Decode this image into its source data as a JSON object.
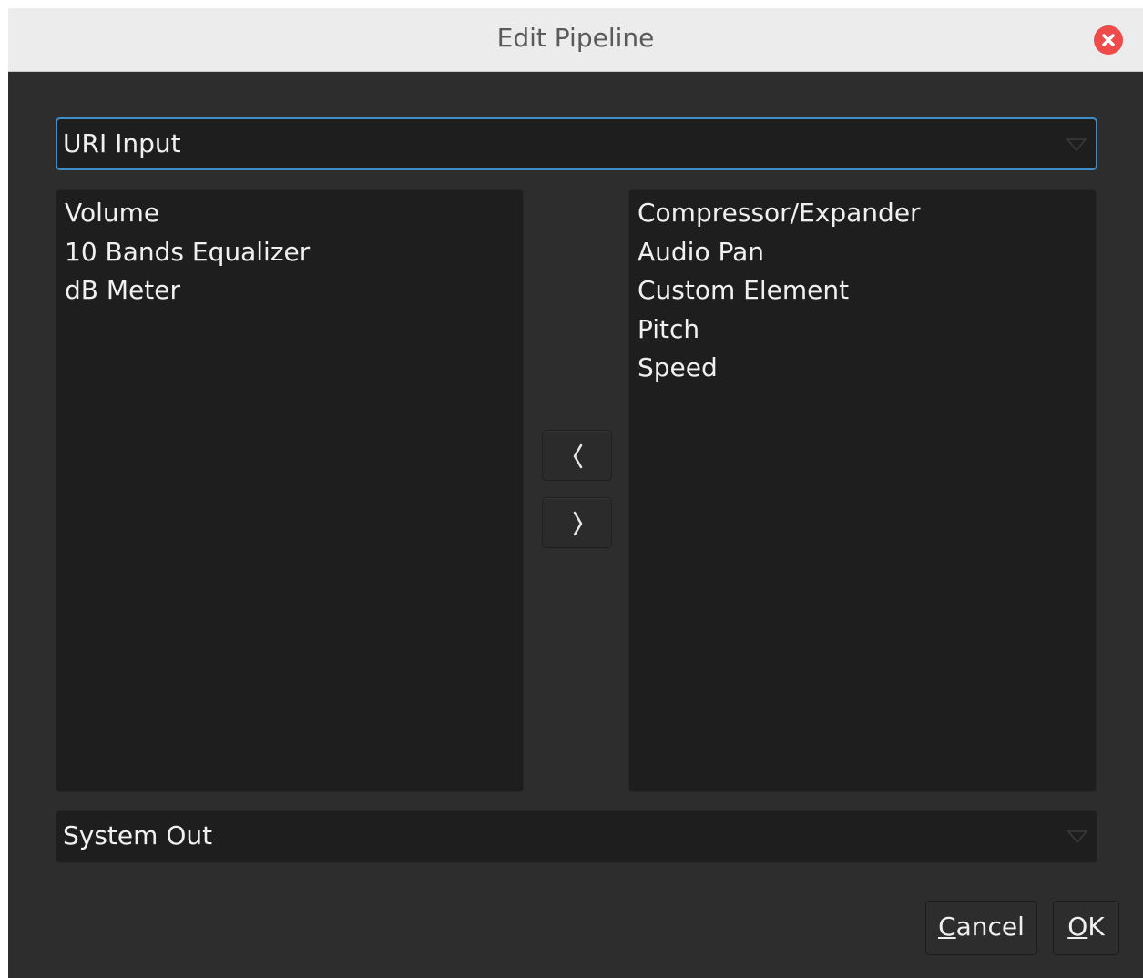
{
  "window": {
    "title": "Edit Pipeline"
  },
  "input_combo": {
    "value": "URI Input"
  },
  "left_list": {
    "items": [
      "Volume",
      "10 Bands Equalizer",
      "dB Meter"
    ]
  },
  "right_list": {
    "items": [
      "Compressor/Expander",
      "Audio Pan",
      "Custom Element",
      "Pitch",
      "Speed"
    ]
  },
  "output_combo": {
    "value": "System Out"
  },
  "buttons": {
    "cancel_mnemonic": "C",
    "cancel_rest": "ancel",
    "ok_mnemonic": "O",
    "ok_rest": "K"
  },
  "icons": {
    "close": "close-icon",
    "move_left": "chevron-left-icon",
    "move_right": "chevron-right-icon",
    "dropdown": "dropdown-triangle-icon"
  },
  "colors": {
    "focus_border": "#3d8ec9",
    "close_button": "#ef4b4b",
    "background": "#2d2d2d",
    "field": "#1e1e1e"
  }
}
